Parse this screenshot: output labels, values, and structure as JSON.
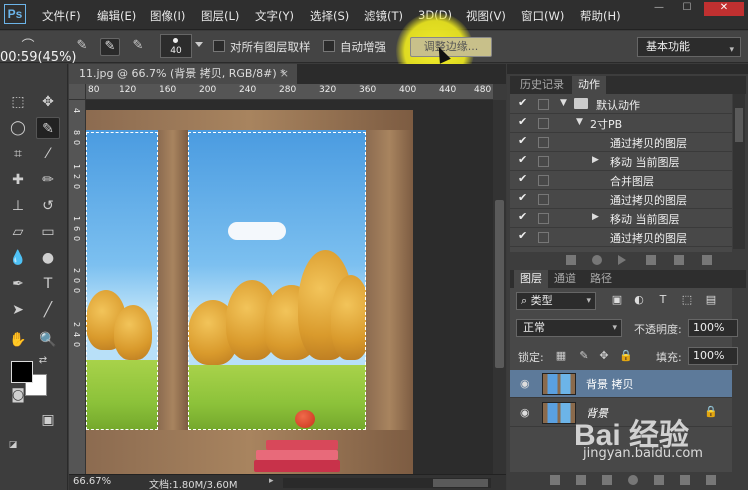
{
  "app": {
    "logo": "Ps"
  },
  "menu": [
    "文件(F)",
    "编辑(E)",
    "图像(I)",
    "图层(L)",
    "文字(Y)",
    "选择(S)",
    "滤镜(T)",
    "3D(D)",
    "视图(V)",
    "窗口(W)",
    "帮助(H)"
  ],
  "options": {
    "brush_size": "40",
    "sample_all_layers": "对所有图层取样",
    "auto_enhance": "自动增强",
    "refine_edge": "调整边缘...",
    "workspace": "基本功能"
  },
  "overlay": {
    "timer": "00:59(45%)"
  },
  "document": {
    "tab_title": "11.jpg @ 66.7% (背景 拷贝, RGB/8#) *",
    "ruler_ticks": [
      "80",
      "120",
      "160",
      "200",
      "240",
      "280",
      "320",
      "360",
      "400",
      "440",
      "480"
    ],
    "vruler_ticks": [
      "4",
      "8",
      "0",
      "1",
      "2",
      "0",
      "1",
      "6",
      "0",
      "2",
      "0",
      "0",
      "2",
      "4",
      "0"
    ]
  },
  "status": {
    "zoom": "66.67%",
    "doc_info": "文档:1.80M/3.60M"
  },
  "history_panel": {
    "tabs": [
      "历史记录",
      "动作"
    ],
    "active_tab": 1,
    "rows": [
      {
        "label": "默认动作",
        "indent": 1,
        "expand": "open",
        "folder": true
      },
      {
        "label": "2寸PB",
        "indent": 2,
        "expand": "open"
      },
      {
        "label": "通过拷贝的图层",
        "indent": 3,
        "expand": ""
      },
      {
        "label": "移动 当前图层",
        "indent": 3,
        "expand": "closed"
      },
      {
        "label": "合并图层",
        "indent": 3,
        "expand": ""
      },
      {
        "label": "通过拷贝的图层",
        "indent": 3,
        "expand": ""
      },
      {
        "label": "移动 当前图层",
        "indent": 3,
        "expand": "closed"
      },
      {
        "label": "通过拷贝的图层",
        "indent": 3,
        "expand": ""
      }
    ]
  },
  "layers_panel": {
    "tabs": [
      "图层",
      "通道",
      "路径"
    ],
    "active_tab": 0,
    "filter": "类型",
    "blend_mode": "正常",
    "opacity_label": "不透明度:",
    "opacity": "100%",
    "lock_label": "锁定:",
    "fill_label": "填充:",
    "fill": "100%",
    "layers": [
      {
        "name": "背景 拷贝",
        "selected": true,
        "locked": false
      },
      {
        "name": "背景",
        "selected": false,
        "locked": true
      }
    ]
  },
  "watermark": {
    "logo": "Bai 经验",
    "url": "jingyan.baidu.com"
  },
  "colors": {
    "accent": "#5d7a9a",
    "highlight": "#f5f030"
  }
}
